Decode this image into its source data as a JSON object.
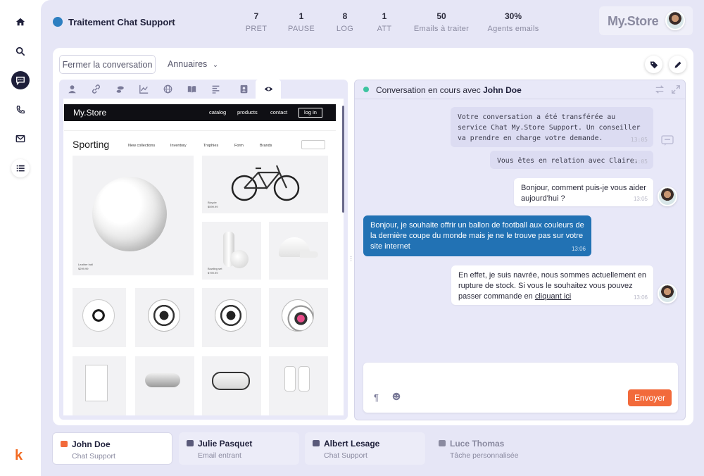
{
  "header": {
    "title": "Traitement Chat Support",
    "stats": [
      {
        "value": "7",
        "label": "PRET"
      },
      {
        "value": "1",
        "label": "PAUSE"
      },
      {
        "value": "8",
        "label": "LOG"
      },
      {
        "value": "1",
        "label": "ATT"
      },
      {
        "value": "50",
        "label": "Emails à traiter"
      },
      {
        "value": "30%",
        "label": "Agents emails"
      }
    ],
    "brand": "My.Store"
  },
  "nav": {
    "items": [
      "home-icon",
      "search-icon",
      "chat-icon",
      "phone-icon",
      "mail-icon",
      "list-icon"
    ],
    "active": "chat-icon",
    "logo": "k"
  },
  "toolbar": {
    "close_label": "Fermer la conversation",
    "directory_label": "Annuaires"
  },
  "left_tabs": [
    "user-icon",
    "link-icon",
    "footprint-icon",
    "chart-icon",
    "globe-icon",
    "book-icon",
    "text-icon",
    "contact-icon",
    "eye-icon"
  ],
  "site": {
    "logo": "My.Store",
    "menu": [
      "catalog",
      "products",
      "contact"
    ],
    "login": "log in",
    "heading": "Sporting",
    "categories": [
      "New collections",
      "Inventory",
      "Trophies",
      "Form",
      "Brands"
    ],
    "tiles": [
      {
        "caption": "Leather ball",
        "price": "$299.99"
      },
      {
        "caption": "Bicycle",
        "price": "$599.99"
      },
      {
        "caption": "Bowling set",
        "price": "$799.99"
      }
    ]
  },
  "chat": {
    "header_prefix": "Conversation en cours avec",
    "contact": "John Doe",
    "messages": [
      {
        "type": "system",
        "text": "Votre conversation a été transférée au service Chat My.Store Support. Un conseiller va prendre en charge votre demande.",
        "time": "13:05"
      },
      {
        "type": "system",
        "text": "Vous êtes en relation avec Claire.",
        "time": "13:05"
      },
      {
        "type": "agent",
        "text": "Bonjour, comment puis-je vous aider aujourd'hui ?",
        "time": "13:05"
      },
      {
        "type": "user",
        "text": "Bonjour, je souhaite offrir un ballon de football aux couleurs de la dernière coupe du monde mais je ne le trouve pas sur votre site internet",
        "time": "13:06"
      },
      {
        "type": "agent",
        "text": "En effet, je suis navrée, nous sommes actuellement en rupture de stock. Si vous le souhaitez vous pouvez passer commande en",
        "link": "cliquant ici",
        "time": "13:06"
      }
    ],
    "send_label": "Envoyer"
  },
  "conversations": [
    {
      "name": "John Doe",
      "channel": "Chat Support",
      "icon": "chat-icon",
      "color": "#f26a3b",
      "active": true
    },
    {
      "name": "Julie Pasquet",
      "channel": "Email entrant",
      "icon": "mail-icon",
      "color": "#5a5a7a"
    },
    {
      "name": "Albert Lesage",
      "channel": "Chat Support",
      "icon": "chat-icon",
      "color": "#5a5a7a"
    },
    {
      "name": "Luce Thomas",
      "channel": "Tâche personnalisée",
      "icon": "folder-icon",
      "color": "#8a8aa0",
      "muted": true
    }
  ],
  "colors": {
    "accent": "#2272b4",
    "send": "#f26a3b",
    "nav_active": "#1e1f3a",
    "online": "#3ec4a0"
  }
}
